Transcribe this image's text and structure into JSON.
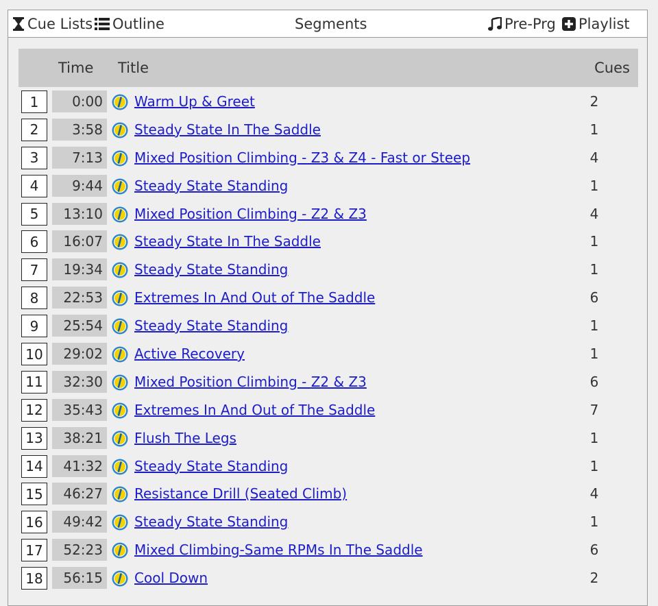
{
  "nav": {
    "cue_lists": "Cue Lists",
    "outline": "Outline",
    "segments": "Segments",
    "pre_prg": "Pre-Prg",
    "playlist": "Playlist"
  },
  "table": {
    "headers": {
      "time": "Time",
      "title": "Title",
      "cues": "Cues"
    },
    "rows": [
      {
        "num": "1",
        "time": "0:00",
        "title": "Warm Up & Greet",
        "cues": "2"
      },
      {
        "num": "2",
        "time": "3:58",
        "title": "Steady State In The Saddle",
        "cues": "1"
      },
      {
        "num": "3",
        "time": "7:13",
        "title": "Mixed Position Climbing - Z3 & Z4 - Fast or Steep",
        "cues": "4"
      },
      {
        "num": "4",
        "time": "9:44",
        "title": "Steady State Standing",
        "cues": "1"
      },
      {
        "num": "5",
        "time": "13:10",
        "title": "Mixed Position Climbing - Z2 & Z3",
        "cues": "4"
      },
      {
        "num": "6",
        "time": "16:07",
        "title": "Steady State In The Saddle",
        "cues": "1"
      },
      {
        "num": "7",
        "time": "19:34",
        "title": "Steady State Standing",
        "cues": "1"
      },
      {
        "num": "8",
        "time": "22:53",
        "title": "Extremes In And Out of The Saddle",
        "cues": "6"
      },
      {
        "num": "9",
        "time": "25:54",
        "title": "Steady State Standing",
        "cues": "1"
      },
      {
        "num": "10",
        "time": "29:02",
        "title": "Active Recovery",
        "cues": "1"
      },
      {
        "num": "11",
        "time": "32:30",
        "title": "Mixed Position Climbing - Z2 & Z3",
        "cues": "6"
      },
      {
        "num": "12",
        "time": "35:43",
        "title": "Extremes In And Out of The Saddle",
        "cues": "7"
      },
      {
        "num": "13",
        "time": "38:21",
        "title": "Flush The Legs",
        "cues": "1"
      },
      {
        "num": "14",
        "time": "41:32",
        "title": "Steady State Standing",
        "cues": "1"
      },
      {
        "num": "15",
        "time": "46:27",
        "title": "Resistance Drill (Seated Climb)",
        "cues": "4"
      },
      {
        "num": "16",
        "time": "49:42",
        "title": "Steady State Standing",
        "cues": "1"
      },
      {
        "num": "17",
        "time": "52:23",
        "title": "Mixed Climbing-Same RPMs In The Saddle",
        "cues": "6"
      },
      {
        "num": "18",
        "time": "56:15",
        "title": "Cool Down",
        "cues": "2"
      }
    ]
  },
  "icons": {
    "cue_lists": "hourglass-icon",
    "outline": "list-icon",
    "pre_prg": "music-note-icon",
    "playlist": "plus-square-icon",
    "row_info": "info-icon"
  },
  "colors": {
    "link": "#1d1dc8",
    "info_icon_ring": "#2f86c7",
    "info_icon_center": "#f2d200"
  }
}
